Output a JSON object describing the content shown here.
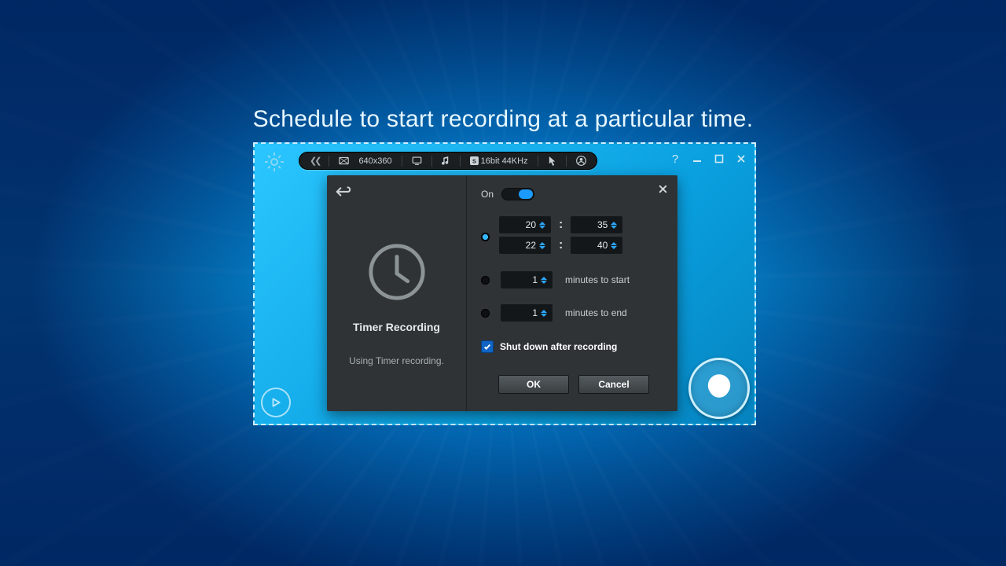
{
  "headline": "Schedule to start recording at a particular time.",
  "toolbar": {
    "resolution": "640x360",
    "audio_format": "16bit 44KHz"
  },
  "dialog": {
    "title": "Timer Recording",
    "subtitle": "Using Timer recording.",
    "on_label": "On",
    "toggle_on": true,
    "time_from_hh": "20",
    "time_from_mm": "35",
    "time_to_hh": "22",
    "time_to_mm": "40",
    "start_value": "1",
    "start_label": "minutes to start",
    "end_value": "1",
    "end_label": "minutes to end",
    "shutdown_label": "Shut down after recording",
    "ok": "OK",
    "cancel": "Cancel"
  }
}
